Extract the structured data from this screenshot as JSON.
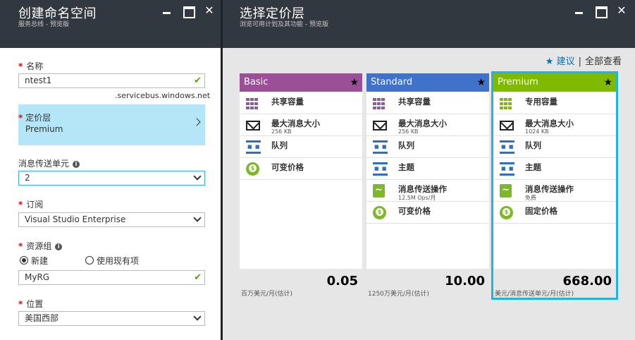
{
  "left_blade": {
    "title": "创建命名空间",
    "subtitle": "服务总线 - 预览版",
    "name_label": "名称",
    "name_value": "ntest1",
    "name_suffix": ".servicebus.windows.net",
    "tier_label": "定价层",
    "tier_value": "Premium",
    "units_label": "消息传送单元",
    "units_value": "2",
    "subscription_label": "订阅",
    "subscription_value": "Visual Studio Enterprise",
    "rg_label": "资源组",
    "rg_new_label": "新建",
    "rg_existing_label": "使用现有项",
    "rg_value": "MyRG",
    "location_label": "位置",
    "location_value": "美国西部"
  },
  "right_blade": {
    "title": "选择定价层",
    "subtitle": "浏览可用计划及其功能 - 预览版",
    "recommend_label": "★ 建议",
    "sep": "|",
    "view_all_label": "全部查看"
  },
  "cards": [
    {
      "name": "Basic",
      "color": "#9b4f96",
      "features": [
        {
          "icon": "grid-icon",
          "label": "共享容量",
          "sub": ""
        },
        {
          "icon": "mail-icon",
          "label": "最大消息大小",
          "sub": "256 KB"
        },
        {
          "icon": "queue-icon",
          "label": "队列",
          "sub": ""
        },
        {
          "icon": "coin-icon",
          "label": "可变价格",
          "sub": ""
        }
      ],
      "price": "0.05",
      "unit": "百万美元/月(估计)"
    },
    {
      "name": "Standard",
      "color": "#3f72c8",
      "features": [
        {
          "icon": "grid-icon",
          "label": "共享容量",
          "sub": ""
        },
        {
          "icon": "mail-icon",
          "label": "最大消息大小",
          "sub": "256 KB"
        },
        {
          "icon": "queue-icon",
          "label": "队列",
          "sub": ""
        },
        {
          "icon": "topic-icon",
          "label": "主题",
          "sub": ""
        },
        {
          "icon": "pulse-icon",
          "label": "消息传送操作",
          "sub": "12.5M Ops/月"
        },
        {
          "icon": "coin-icon",
          "label": "可变价格",
          "sub": ""
        }
      ],
      "price": "10.00",
      "unit": "1250万美元/月(估计)"
    },
    {
      "name": "Premium",
      "color": "#7fb900",
      "features": [
        {
          "icon": "grid-icon",
          "label": "专用容量",
          "sub": ""
        },
        {
          "icon": "mail-icon",
          "label": "最大消息大小",
          "sub": "1024 KB"
        },
        {
          "icon": "queue-icon",
          "label": "队列",
          "sub": ""
        },
        {
          "icon": "topic-icon",
          "label": "主题",
          "sub": ""
        },
        {
          "icon": "pulse-icon",
          "label": "消息传送操作",
          "sub": "免费"
        },
        {
          "icon": "coin-icon",
          "label": "固定价格",
          "sub": ""
        }
      ],
      "price": "668.00",
      "unit": "美元/消息传送单元/月(估计)"
    }
  ]
}
